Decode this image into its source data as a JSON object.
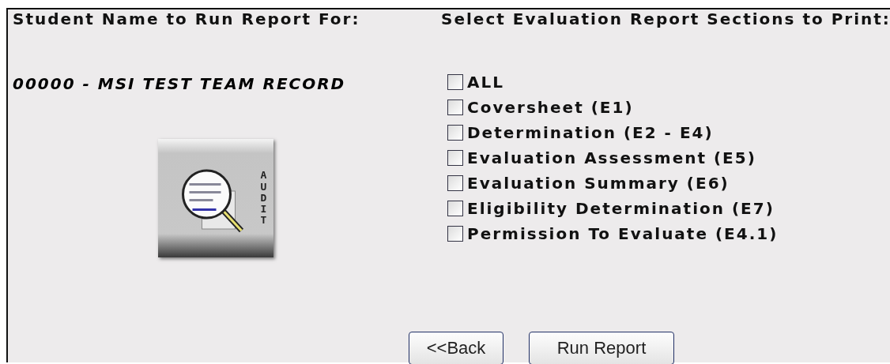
{
  "student": {
    "heading": "Student Name to Run Report For:",
    "name": "00000 - MSI TEST TEAM RECORD",
    "audit_button": {
      "label": "AUDIT"
    }
  },
  "sections": {
    "heading": "Select Evaluation Report Sections to Print:",
    "options": [
      {
        "label": "ALL",
        "checked": false
      },
      {
        "label": "Coversheet (E1)",
        "checked": false
      },
      {
        "label": "Determination (E2 - E4)",
        "checked": false
      },
      {
        "label": "Evaluation Assessment (E5)",
        "checked": false
      },
      {
        "label": "Evaluation Summary (E6)",
        "checked": false
      },
      {
        "label": "Eligibility Determination (E7)",
        "checked": false
      },
      {
        "label": "Permission To Evaluate (E4.1)",
        "checked": false
      }
    ]
  },
  "buttons": [
    "<<Back",
    "Run Report"
  ]
}
